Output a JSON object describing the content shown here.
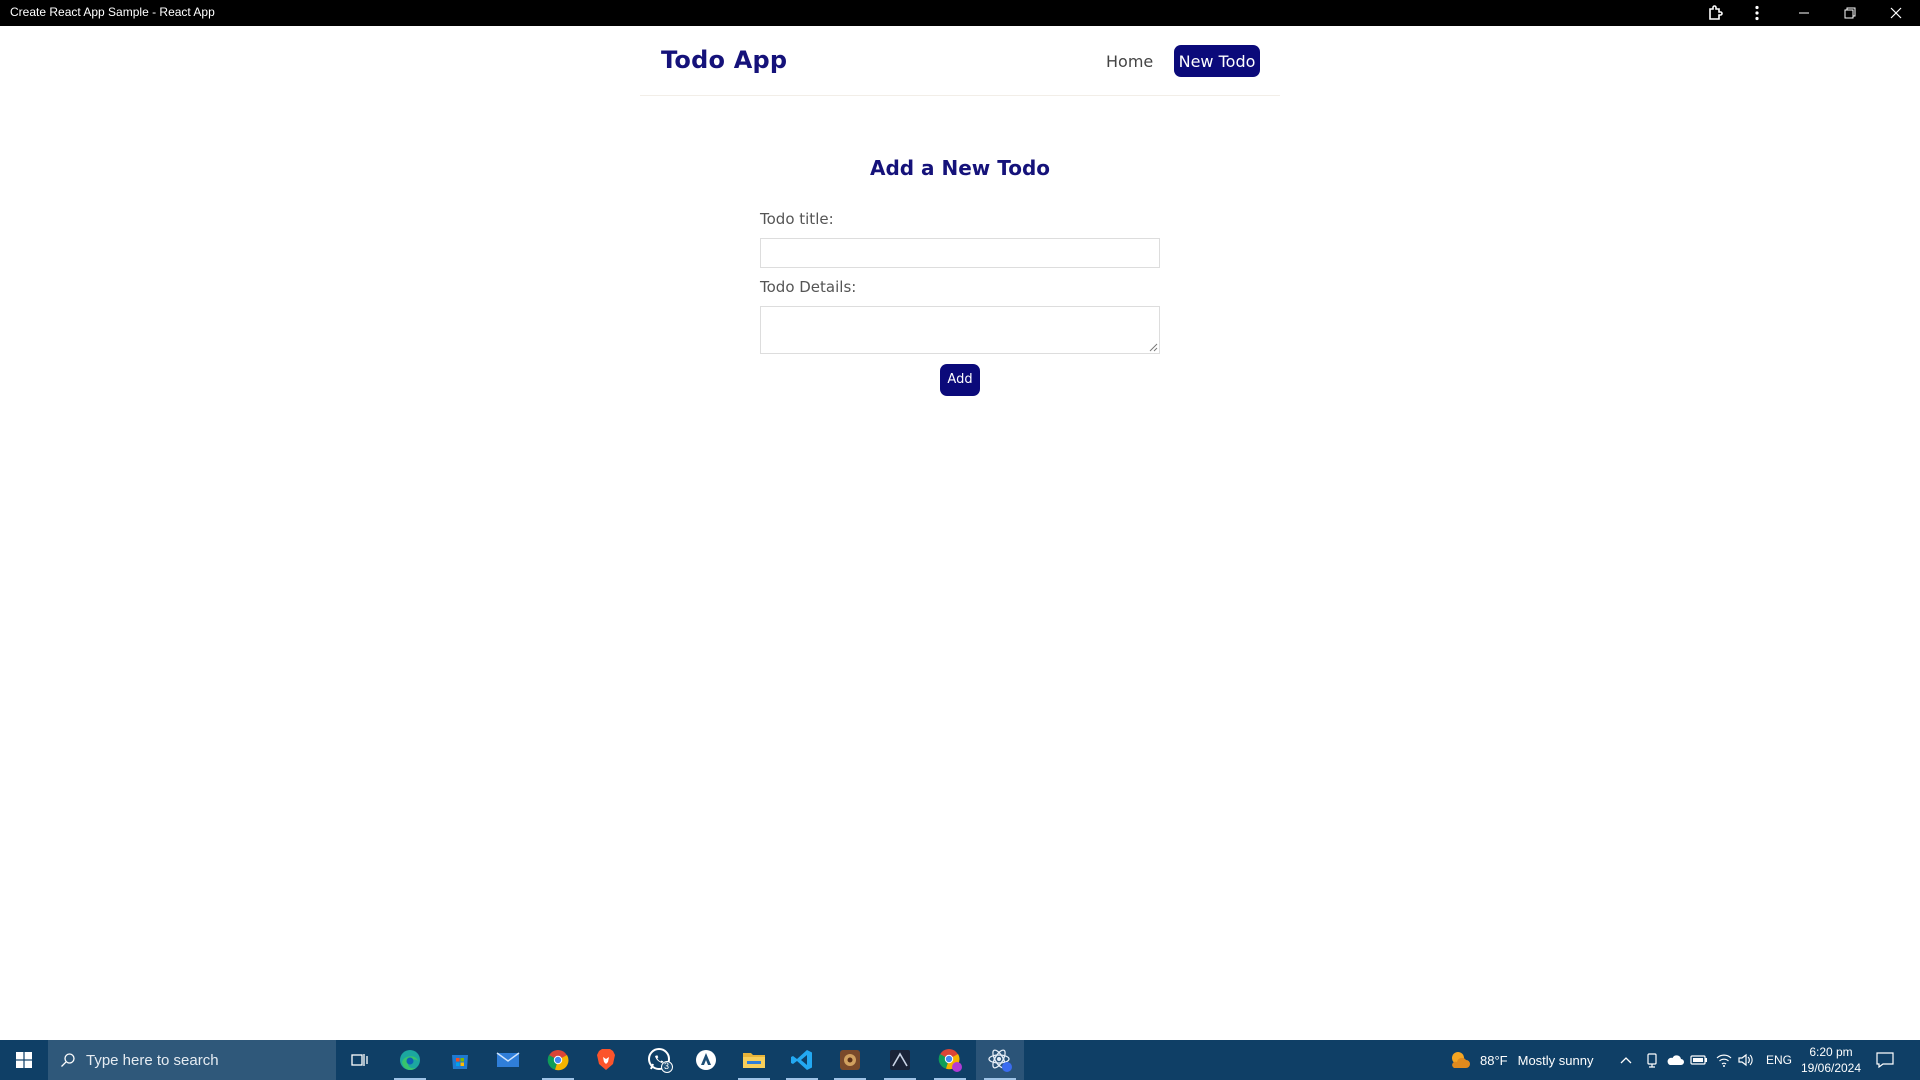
{
  "window": {
    "title": "Create React App Sample - React App",
    "buttons": [
      "extensions-icon",
      "more-icon",
      "minimize-icon",
      "restore-icon",
      "close-icon"
    ]
  },
  "app": {
    "brand": "Todo App",
    "nav": {
      "home": "Home",
      "new_todo": "New Todo"
    },
    "form": {
      "heading": "Add a New Todo",
      "title_label": "Todo title:",
      "title_value": "",
      "details_label": "Todo Details:",
      "details_value": "",
      "add_button": "Add"
    },
    "colors": {
      "brand": "#15127a",
      "button": "#0b0a7a",
      "text": "#555555"
    }
  },
  "taskbar": {
    "search_placeholder": "Type here to search",
    "apps": [
      "task-view-icon",
      "edge-icon",
      "store-icon",
      "mail-icon",
      "chrome-icon",
      "brave-icon",
      "whatsapp-icon",
      "app-icon",
      "file-explorer-icon",
      "vscode-icon",
      "game-icon",
      "app-icon",
      "chrome-profile-icon",
      "react-app-icon"
    ],
    "whatsapp_badge": "3",
    "weather": {
      "temp": "88°F",
      "condition": "Mostly sunny"
    },
    "language": "ENG",
    "time": "6:20 pm",
    "date": "19/06/2024",
    "colors": {
      "taskbar": "#0f3f66"
    }
  }
}
